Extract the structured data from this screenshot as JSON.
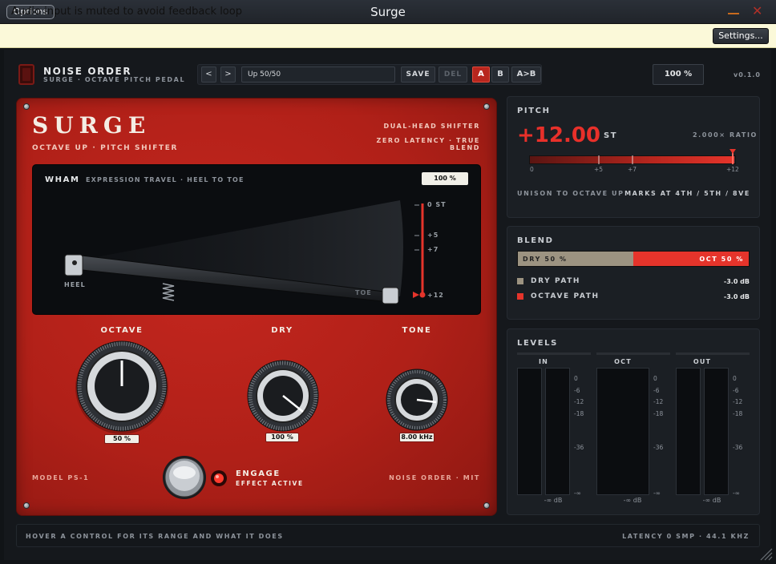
{
  "window": {
    "title": "Surge",
    "options_label": "Options",
    "minimize_symbol": "—",
    "close_symbol": "✕"
  },
  "notice": {
    "text": "Audio input is muted to avoid feedback loop",
    "settings_label": "Settings..."
  },
  "header": {
    "brand": "NOISE ORDER",
    "subtitle": "SURGE · OCTAVE PITCH PEDAL",
    "prev_label": "<",
    "next_label": ">",
    "preset_name": "Up 50/50",
    "save_label": "SAVE",
    "del_label": "DEL",
    "slot_a": "A",
    "slot_b": "B",
    "slot_copy": "A>B",
    "mix_value": "100 %",
    "version": "v0.1.0"
  },
  "pedal": {
    "title": "SURGE",
    "subtitle": "OCTAVE UP · PITCH SHIFTER",
    "feature_1": "DUAL-HEAD SHIFTER",
    "feature_2": "ZERO LATENCY · TRUE BLEND",
    "wham": {
      "title": "WHAM",
      "subtitle": "EXPRESSION TRAVEL · HEEL TO TOE",
      "value": "100 %",
      "heel_label": "HEEL",
      "toe_label": "TOE",
      "scale": [
        "0 ST",
        "+5",
        "+7",
        "+12"
      ],
      "level_percent": 100
    },
    "knobs": [
      {
        "label": "OCTAVE",
        "value": "50 %"
      },
      {
        "label": "DRY",
        "value": "100 %"
      },
      {
        "label": "TONE",
        "value": "8.00 kHz"
      }
    ],
    "model": "MODEL PS-1",
    "maker": "NOISE ORDER · MIT",
    "engage_label": "ENGAGE",
    "engage_sub": "EFFECT ACTIVE"
  },
  "pitch": {
    "title": "PITCH",
    "value": "+12.00",
    "unit": "ST",
    "ratio": "2.000× RATIO",
    "scale": [
      "0",
      "+5",
      "+7",
      "+12"
    ],
    "help": "UNISON TO OCTAVE UP",
    "marks": "MARKS AT 4TH / 5TH / 8VE",
    "level_semitones": 12
  },
  "blend": {
    "title": "BLEND",
    "dry_label": "DRY 50 %",
    "oct_label": "OCT 50 %",
    "dry_path_label": "DRY PATH",
    "dry_path_value": "-3.0 dB",
    "oct_path_label": "OCTAVE PATH",
    "oct_path_value": "-3.0 dB",
    "dry_fraction": 0.5
  },
  "levels": {
    "title": "LEVELS",
    "groups": [
      {
        "label": "IN",
        "readout": "-∞ dB"
      },
      {
        "label": "OCT",
        "readout": "-∞ dB"
      },
      {
        "label": "OUT",
        "readout": "-∞ dB"
      }
    ],
    "scale": [
      "0",
      "-6",
      "-12",
      "-18",
      "-36",
      "-∞"
    ]
  },
  "status": {
    "hint": "HOVER A CONTROL FOR ITS RANGE AND WHAT IT DOES",
    "latency": "LATENCY 0 SMP",
    "rate": "44.1 KHZ"
  },
  "colors": {
    "accent": "#e5342b",
    "pedal": "#b8241c",
    "dry": "#9c9381"
  }
}
